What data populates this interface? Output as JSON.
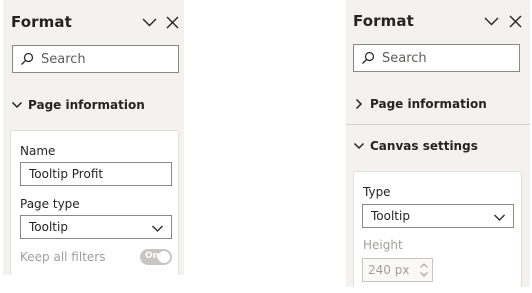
{
  "left_pane": {
    "title": "Format",
    "search": {
      "placeholder": "Search"
    },
    "section": {
      "label": "Page information",
      "expanded": true
    },
    "name_field": {
      "label": "Name",
      "value": "Tooltip Profit"
    },
    "page_type": {
      "label": "Page type",
      "selected": "Tooltip"
    },
    "keep_filters": {
      "label": "Keep all filters",
      "toggle_text": "On",
      "enabled": false
    }
  },
  "right_pane": {
    "title": "Format",
    "search": {
      "placeholder": "Search"
    },
    "sections": [
      {
        "label": "Page information",
        "expanded": false
      },
      {
        "label": "Canvas settings",
        "expanded": true
      }
    ],
    "type_field": {
      "label": "Type",
      "selected": "Tooltip"
    },
    "height_field": {
      "label": "Height",
      "value": "240 px",
      "enabled": false
    }
  },
  "icons": {
    "collapse": "chevron-down-icon",
    "close": "close-icon",
    "search": "search-icon",
    "section_expanded": "chevron-down-icon",
    "section_collapsed": "chevron-right-icon"
  },
  "colors": {
    "pane_background": "#f3f2f1",
    "card_background": "#ffffff",
    "text": "#252423",
    "disabled_text": "#a19f9d",
    "border": "#8a8886",
    "toggle_off": "#c8c6c4"
  }
}
